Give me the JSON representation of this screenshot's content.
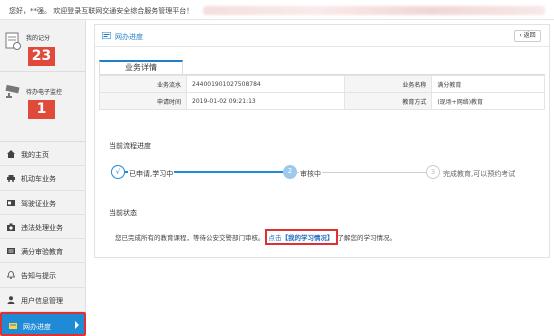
{
  "topbar": {
    "greeting": "您好，**强。 欢迎登录互联网交通安全综合服务管理平台！"
  },
  "sidebar": {
    "score_label": "我的记分",
    "score_value": "23",
    "pending_label": "待办电子监控",
    "pending_value": "1",
    "items": [
      {
        "label": "我的主页",
        "icon": "home-icon"
      },
      {
        "label": "机动车业务",
        "icon": "car-icon"
      },
      {
        "label": "驾驶证业务",
        "icon": "license-icon"
      },
      {
        "label": "违法处理业务",
        "icon": "camera-icon"
      },
      {
        "label": "满分审验教育",
        "icon": "education-icon"
      },
      {
        "label": "告知与提示",
        "icon": "bell-icon"
      },
      {
        "label": "用户信息管理",
        "icon": "user-icon"
      },
      {
        "label": "网办进度",
        "icon": "progress-icon",
        "active": true
      }
    ]
  },
  "main": {
    "title": "网办进度",
    "back_label": "返回",
    "tab_label": "业务详情",
    "info": {
      "row1": {
        "k1": "业务流水",
        "v1": "244001901027508784",
        "k2": "业务名称",
        "v2": "满分教育"
      },
      "row2": {
        "k1": "申请时间",
        "v1": "2019-01-02 09:21:13",
        "k2": "教育方式",
        "v2": "(现场+网络)教育"
      }
    },
    "progress_title": "当前流程进度",
    "steps": [
      {
        "num": "√",
        "label": "已申请,学习中"
      },
      {
        "num": "2",
        "label": "审核中"
      },
      {
        "num": "3",
        "label": "完成教育,可以预约考试"
      }
    ],
    "status_title": "当前状态",
    "status_prefix": "您已完成所有的教育课程，等待公安交警部门审核。",
    "status_link_pre": "点击",
    "status_link": "【我的学习情况】",
    "status_suffix": "了解您的学习情况。"
  },
  "colors": {
    "accent": "#1f8ad6",
    "badge": "#e04a3b",
    "highlight": "#e03030"
  }
}
